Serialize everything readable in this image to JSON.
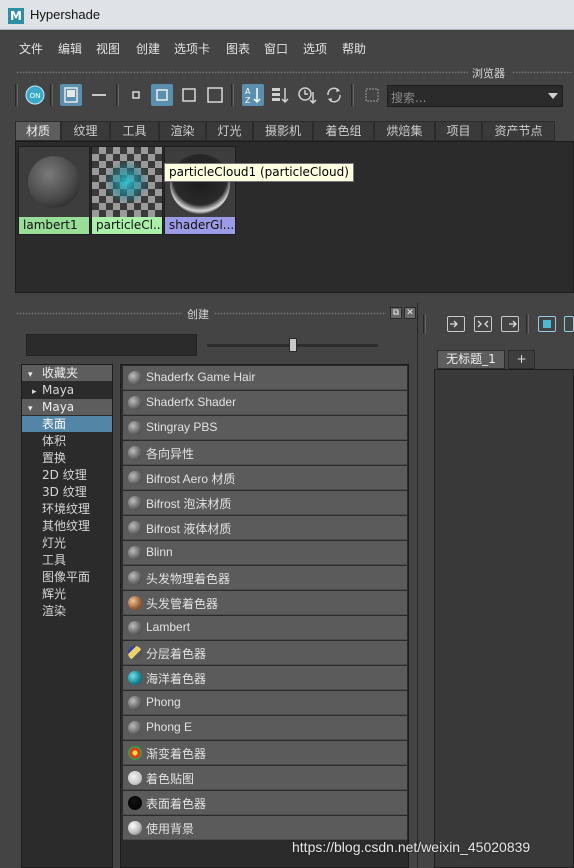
{
  "window": {
    "title": "Hypershade",
    "app_icon_letter": "M"
  },
  "menu": [
    "文件",
    "编辑",
    "视图",
    "创建",
    "选项卡",
    "图表",
    "窗口",
    "选项",
    "帮助"
  ],
  "toolbar": {
    "section_label": "浏览器",
    "on_label": "ON",
    "search_placeholder": "搜索..."
  },
  "tabs": [
    {
      "label": "材质",
      "selected": true
    },
    {
      "label": "纹理",
      "selected": false
    },
    {
      "label": "工具",
      "selected": false
    },
    {
      "label": "渲染",
      "selected": false
    },
    {
      "label": "灯光",
      "selected": false
    },
    {
      "label": "摄影机",
      "selected": false
    },
    {
      "label": "着色组",
      "selected": false
    },
    {
      "label": "烘焙集",
      "selected": false
    },
    {
      "label": "项目",
      "selected": false
    },
    {
      "label": "资产节点",
      "selected": false
    }
  ],
  "swatches": [
    {
      "label": "lambert1",
      "label_color": "#98dd98"
    },
    {
      "label": "particleCl...",
      "label_color": "#aaf0aa"
    },
    {
      "label": "shaderGl...",
      "label_color": "#9c9ce6"
    }
  ],
  "tooltip": "particleCloud1 (particleCloud)",
  "create_panel": {
    "label": "创建",
    "restore_icon": "⧉",
    "close_icon": "✕"
  },
  "tree": [
    {
      "label": "收藏夹",
      "type": "group",
      "expander": "▾"
    },
    {
      "label": "Maya",
      "type": "child-collapsed",
      "expander": "▸"
    },
    {
      "label": "Maya",
      "type": "group",
      "expander": "▾"
    },
    {
      "label": "表面",
      "type": "selected"
    },
    {
      "label": "体积",
      "type": "item"
    },
    {
      "label": "置换",
      "type": "item"
    },
    {
      "label": "2D 纹理",
      "type": "item"
    },
    {
      "label": "3D 纹理",
      "type": "item"
    },
    {
      "label": "环境纹理",
      "type": "item"
    },
    {
      "label": "其他纹理",
      "type": "item"
    },
    {
      "label": "灯光",
      "type": "item"
    },
    {
      "label": "工具",
      "type": "item"
    },
    {
      "label": "图像平面",
      "type": "item"
    },
    {
      "label": "辉光",
      "type": "item"
    },
    {
      "label": "渲染",
      "type": "item"
    }
  ],
  "nodes": [
    {
      "label": "Shaderfx Game Hair",
      "icon": "gray-sphere-icon"
    },
    {
      "label": "Shaderfx Shader",
      "icon": "gray-sphere-icon"
    },
    {
      "label": "Stingray PBS",
      "icon": "gray-sphere-icon"
    },
    {
      "label": "各向异性",
      "icon": "gray-sphere-icon"
    },
    {
      "label": "Bifrost Aero 材质",
      "icon": "gray-sphere-icon"
    },
    {
      "label": "Bifrost 泡沫材质",
      "icon": "gray-sphere-icon"
    },
    {
      "label": "Bifrost 液体材质",
      "icon": "gray-sphere-icon"
    },
    {
      "label": "Blinn",
      "icon": "gray-sphere-icon"
    },
    {
      "label": "头发物理着色器",
      "icon": "gray-sphere-icon"
    },
    {
      "label": "头发管着色器",
      "icon": "brown-sphere-icon"
    },
    {
      "label": "Lambert",
      "icon": "gray-sphere-icon"
    },
    {
      "label": "分层着色器",
      "icon": "layered-sphere-icon"
    },
    {
      "label": "海洋着色器",
      "icon": "ocean-sphere-icon"
    },
    {
      "label": "Phong",
      "icon": "gray-sphere-icon"
    },
    {
      "label": "Phong E",
      "icon": "gray-sphere-icon"
    },
    {
      "label": "渐变着色器",
      "icon": "ramp-sphere-icon"
    },
    {
      "label": "着色贴图",
      "icon": "light-sphere-icon"
    },
    {
      "label": "表面着色器",
      "icon": "black-sphere-icon"
    },
    {
      "label": "使用背景",
      "icon": "background-sphere-icon"
    }
  ],
  "graph": {
    "tab_label": "无标题_1",
    "add_tab_label": "+"
  },
  "watermark": "https://blog.csdn.net/weixin_45020839"
}
